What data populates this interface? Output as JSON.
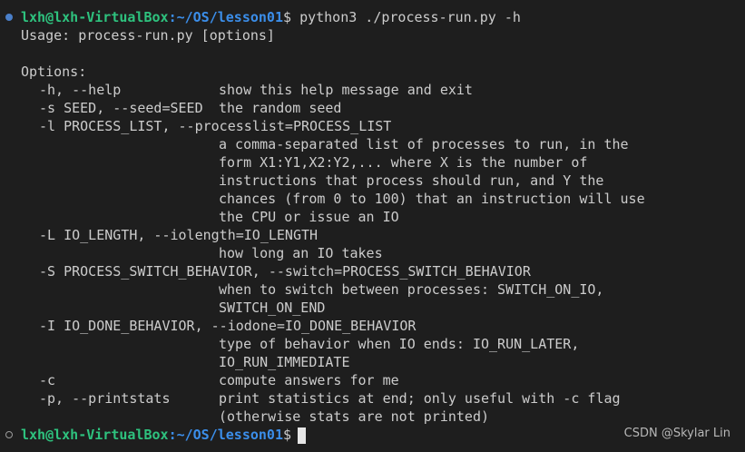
{
  "prompt1": {
    "userhost": "lxh@lxh-VirtualBox",
    "path": ":~/OS/lesson01",
    "symbol": "$",
    "command": "python3 ./process-run.py -h"
  },
  "output": {
    "usage": "Usage: process-run.py [options]",
    "options_header": "Options:",
    "help_opt": "-h, --help",
    "help_desc": "show this help message and exit",
    "seed_opt": "-s SEED, --seed=SEED",
    "seed_desc": "the random seed",
    "proclist_opt": "-l PROCESS_LIST, --processlist=PROCESS_LIST",
    "proclist_desc": [
      "a comma-separated list of processes to run, in the",
      "form X1:Y1,X2:Y2,... where X is the number of",
      "instructions that process should run, and Y the",
      "chances (from 0 to 100) that an instruction will use",
      "the CPU or issue an IO"
    ],
    "iolen_opt": "-L IO_LENGTH, --iolength=IO_LENGTH",
    "iolen_desc": "how long an IO takes",
    "switch_opt": "-S PROCESS_SWITCH_BEHAVIOR, --switch=PROCESS_SWITCH_BEHAVIOR",
    "switch_desc": [
      "when to switch between processes: SWITCH_ON_IO,",
      "SWITCH_ON_END"
    ],
    "iodone_opt": "-I IO_DONE_BEHAVIOR, --iodone=IO_DONE_BEHAVIOR",
    "iodone_desc": [
      "type of behavior when IO ends: IO_RUN_LATER,",
      "IO_RUN_IMMEDIATE"
    ],
    "compute_opt": "-c",
    "compute_desc": "compute answers for me",
    "printstats_opt": "-p, --printstats",
    "printstats_desc": [
      "print statistics at end; only useful with -c flag",
      "(otherwise stats are not printed)"
    ]
  },
  "prompt2": {
    "userhost": "lxh@lxh-VirtualBox",
    "path": ":~/OS/lesson01",
    "symbol": "$"
  },
  "watermark": "CSDN @Skylar Lin",
  "colors": {
    "background": "#1e1e1e",
    "text": "#cccccc",
    "user": "#2ec27e",
    "path": "#3b8eea",
    "marker_done": "#4a7fc9"
  }
}
